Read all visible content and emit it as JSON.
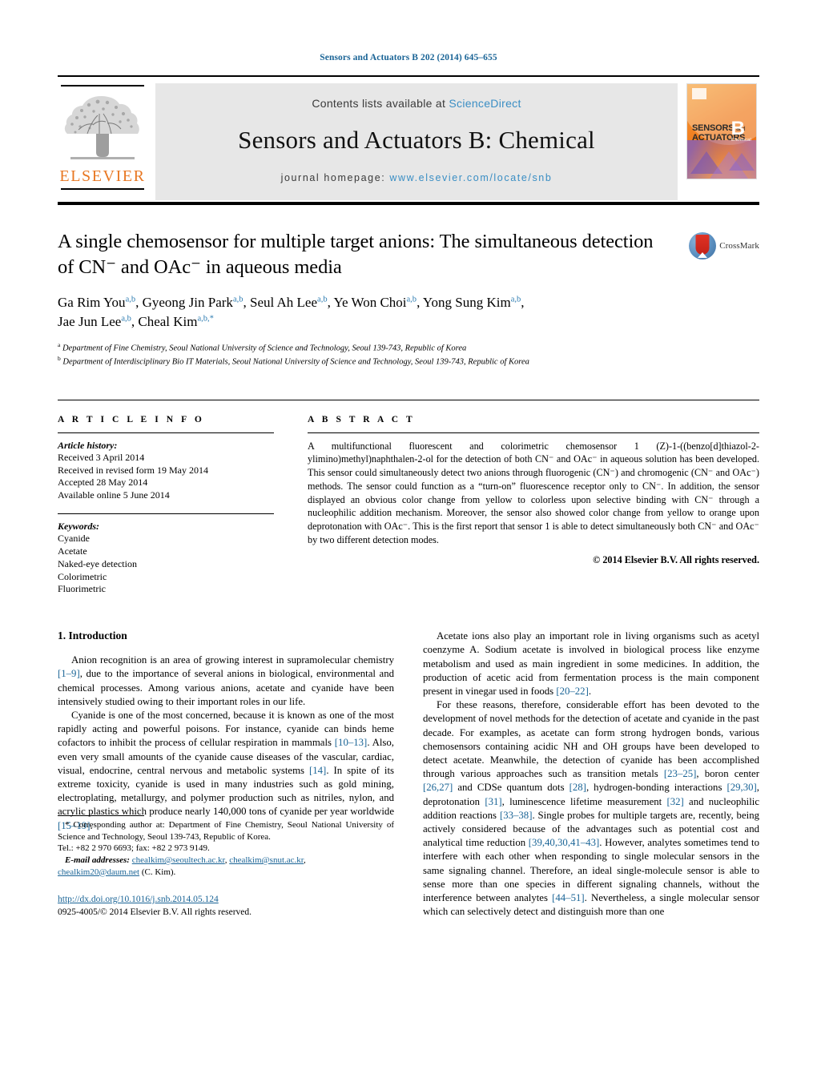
{
  "running_head": "Sensors and Actuators B 202 (2014) 645–655",
  "masthead": {
    "contents_prefix": "Contents lists available at ",
    "contents_link": "ScienceDirect",
    "journal_title": "Sensors and Actuators B: Chemical",
    "homepage_prefix": "journal homepage:",
    "homepage_link": "www.elsevier.com/locate/snb",
    "publisher_logo_text": "ELSEVIER",
    "cover": {
      "line1": "SENSORS",
      "and": "and",
      "line2": "ACTUATORS",
      "volume_letter": "B",
      "volume_sub": "Chemical"
    }
  },
  "article": {
    "title": "A single chemosensor for multiple target anions: The simultaneous detection of CN⁻ and OAc⁻ in aqueous media",
    "authors_html": "Ga Rim You, Gyeong Jin Park, Seul Ah Lee, Ye Won Choi, Yong Sung Kim, Jae Jun Lee, Cheal Kim",
    "affiliation_a": "Department of Fine Chemistry, Seoul National University of Science and Technology, Seoul 139-743, Republic of Korea",
    "affiliation_b": "Department of Interdisciplinary Bio IT Materials, Seoul National University of Science and Technology, Seoul 139-743, Republic of Korea",
    "crossmark_label": "CrossMark"
  },
  "article_info": {
    "heading": "A R T I C L E    I N F O",
    "history_label": "Article history:",
    "history": [
      "Received 3 April 2014",
      "Received in revised form 19 May 2014",
      "Accepted 28 May 2014",
      "Available online 5 June 2014"
    ],
    "keywords_label": "Keywords:",
    "keywords": [
      "Cyanide",
      "Acetate",
      "Naked-eye detection",
      "Colorimetric",
      "Fluorimetric"
    ]
  },
  "abstract": {
    "heading": "A B S T R A C T",
    "text": "A multifunctional fluorescent and colorimetric chemosensor 1 (Z)-1-((benzo[d]thiazol-2-ylimino)methyl)naphthalen-2-ol for the detection of both CN⁻ and OAc⁻ in aqueous solution has been developed. This sensor could simultaneously detect two anions through fluorogenic (CN⁻) and chromogenic (CN⁻ and OAc⁻) methods. The sensor could function as a “turn-on” fluorescence receptor only to CN⁻. In addition, the sensor displayed an obvious color change from yellow to colorless upon selective binding with CN⁻ through a nucleophilic addition mechanism. Moreover, the sensor also showed color change from yellow to orange upon deprotonation with OAc⁻. This is the first report that sensor 1 is able to detect simultaneously both CN⁻ and OAc⁻ by two different detection modes.",
    "copyright": "© 2014 Elsevier B.V. All rights reserved."
  },
  "body": {
    "section_heading": "1.  Introduction",
    "left_paragraphs": [
      "Anion recognition is an area of growing interest in supramolecular chemistry [1–9], due to the importance of several anions in biological, environmental and chemical processes. Among various anions, acetate and cyanide have been intensively studied owing to their important roles in our life.",
      "Cyanide is one of the most concerned, because it is known as one of the most rapidly acting and powerful poisons. For instance, cyanide can binds heme cofactors to inhibit the process of cellular respiration in mammals [10–13]. Also, even very small amounts of the cyanide cause diseases of the vascular, cardiac, visual, endocrine, central nervous and metabolic systems [14]. In spite of its extreme toxicity, cyanide is used in many industries such as gold mining, electroplating, metallurgy, and polymer production such as nitriles, nylon, and acrylic plastics which produce nearly 140,000 tons of cyanide per year worldwide [15–19]."
    ],
    "right_paragraphs": [
      "Acetate ions also play an important role in living organisms such as acetyl coenzyme A. Sodium acetate is involved in biological process like enzyme metabolism and used as main ingredient in some medicines. In addition, the production of acetic acid from fermentation process is the main component present in vinegar used in foods [20–22].",
      "For these reasons, therefore, considerable effort has been devoted to the development of novel methods for the detection of acetate and cyanide in the past decade. For examples, as acetate can form strong hydrogen bonds, various chemosensors containing acidic NH and OH groups have been developed to detect acetate. Meanwhile, the detection of cyanide has been accomplished through various approaches such as transition metals [23–25], boron center [26,27] and CDSe quantum dots [28], hydrogen-bonding interactions [29,30], deprotonation [31], luminescence lifetime measurement [32] and nucleophilic addition reactions [33–38]. Single probes for multiple targets are, recently, being actively considered because of the advantages such as potential cost and analytical time reduction [39,40,30,41–43]. However, analytes sometimes tend to interfere with each other when responding to single molecular sensors in the same signaling channel. Therefore, an ideal single-molecule sensor is able to sense more than one species in different signaling channels, without the interference between analytes [44–51]. Nevertheless, a single molecular sensor which can selectively detect and distinguish more than one"
    ]
  },
  "footnotes": {
    "corresponding_marker": "*",
    "corresponding_text": "Corresponding author at: Department of Fine Chemistry, Seoul National University of Science and Technology, Seoul 139-743, Republic of Korea.",
    "tel_fax": "Tel.: +82 2 970 6693; fax: +82 2 973 9149.",
    "email_label": "E-mail addresses:",
    "emails": [
      "chealkim@seoultech.ac.kr",
      "chealkim@snut.ac.kr",
      "chealkim20@daum.net"
    ],
    "email_suffix": "(C. Kim).",
    "doi": "http://dx.doi.org/10.1016/j.snb.2014.05.124",
    "issn_line": "0925-4005/© 2014 Elsevier B.V. All rights reserved."
  },
  "colors": {
    "link_blue": "#1a6496",
    "science_direct_blue": "#3a8ec4",
    "elsevier_orange": "#E87722",
    "crossmark_red": "#d62b20"
  }
}
